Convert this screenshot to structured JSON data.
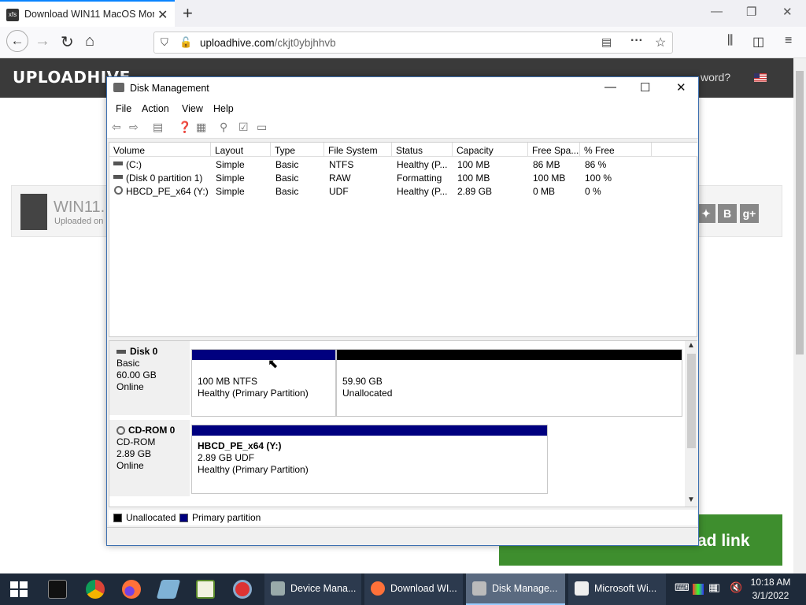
{
  "browser": {
    "tab_title": "Download WIN11 MacOS Mon",
    "url_host": "uploadhive.com",
    "url_path": "/ckjt0ybjhhvb"
  },
  "site": {
    "logo": "UPLOADHIVE",
    "header_tail": "word?",
    "file_name": "WIN11.",
    "file_uploaded": "Uploaded on 2",
    "download_text": "ad link",
    "social": [
      "B",
      "g+"
    ]
  },
  "dm": {
    "title": "Disk Management",
    "menu": [
      "File",
      "Action",
      "View",
      "Help"
    ],
    "columns": [
      "Volume",
      "Layout",
      "Type",
      "File System",
      "Status",
      "Capacity",
      "Free Spa...",
      "% Free"
    ],
    "rows": [
      [
        "(C:)",
        "Simple",
        "Basic",
        "NTFS",
        "Healthy (P...",
        "100 MB",
        "86 MB",
        "86 %"
      ],
      [
        "(Disk 0 partition 1)",
        "Simple",
        "Basic",
        "RAW",
        "Formatting",
        "100 MB",
        "100 MB",
        "100 %"
      ],
      [
        "HBCD_PE_x64 (Y:)",
        "Simple",
        "Basic",
        "UDF",
        "Healthy (P...",
        "2.89 GB",
        "0 MB",
        "0 %"
      ]
    ],
    "disk0": {
      "name": "Disk 0",
      "type": "Basic",
      "size": "60.00 GB",
      "state": "Online",
      "p1_line1": "100 MB NTFS",
      "p1_line2": "Healthy (Primary Partition)",
      "p2_line1": "59.90 GB",
      "p2_line2": "Unallocated"
    },
    "cdrom0": {
      "name": "CD-ROM 0",
      "type": "CD-ROM",
      "size": "2.89 GB",
      "state": "Online",
      "p_name": "HBCD_PE_x64  (Y:)",
      "p_line1": "2.89 GB UDF",
      "p_line2": "Healthy (Primary Partition)"
    },
    "legend": [
      "Unallocated",
      "Primary partition"
    ],
    "colors": {
      "primary": "#00007f",
      "unallocated": "#000000"
    }
  },
  "taskbar": {
    "tasks": [
      "Device Mana...",
      "Download WI...",
      "Disk Manage...",
      "Microsoft Wi..."
    ],
    "time": "10:18 AM",
    "date": "3/1/2022"
  }
}
